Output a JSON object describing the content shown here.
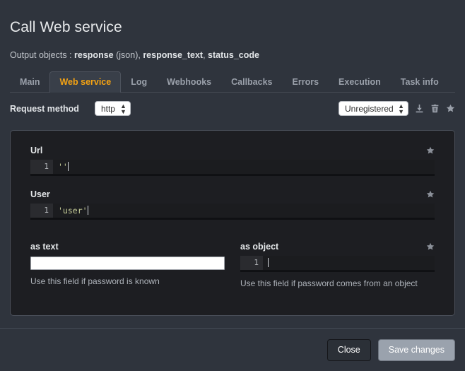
{
  "header": {
    "title": "Call Web service",
    "output_objects_prefix": "Output objects : ",
    "output_objects": [
      {
        "name": "response",
        "suffix": " (json), "
      },
      {
        "name": "response_text",
        "suffix": ", "
      },
      {
        "name": "status_code",
        "suffix": ""
      }
    ]
  },
  "tabs": [
    {
      "label": "Main",
      "active": false
    },
    {
      "label": "Web service",
      "active": true
    },
    {
      "label": "Log",
      "active": false
    },
    {
      "label": "Webhooks",
      "active": false
    },
    {
      "label": "Callbacks",
      "active": false
    },
    {
      "label": "Errors",
      "active": false
    },
    {
      "label": "Execution",
      "active": false
    },
    {
      "label": "Task info",
      "active": false
    }
  ],
  "method_row": {
    "label": "Request method",
    "method_value": "http",
    "method_options": [
      "http"
    ],
    "registration_value": "Unregistered",
    "registration_options": [
      "Unregistered"
    ],
    "icons": [
      "download-icon",
      "trash-icon",
      "star-icon"
    ]
  },
  "fields": {
    "url": {
      "label": "Url",
      "line_number": "1",
      "code": "''",
      "star": "star-icon"
    },
    "user": {
      "label": "User",
      "line_number": "1",
      "code": "'user'",
      "star": "star-icon"
    },
    "as_text": {
      "label": "as text",
      "value": "",
      "placeholder": "",
      "hint": "Use this field if password is known"
    },
    "as_object": {
      "label": "as object",
      "line_number": "1",
      "code": "",
      "hint": "Use this field if password comes from an object",
      "star": "star-icon"
    }
  },
  "footer": {
    "close_label": "Close",
    "save_label": "Save changes"
  },
  "colors": {
    "background": "#2f343d",
    "panel": "#1d1e22",
    "accent": "#f5a313",
    "string_literal": "#c8cf9a",
    "save_button": "#9aa2ad"
  }
}
